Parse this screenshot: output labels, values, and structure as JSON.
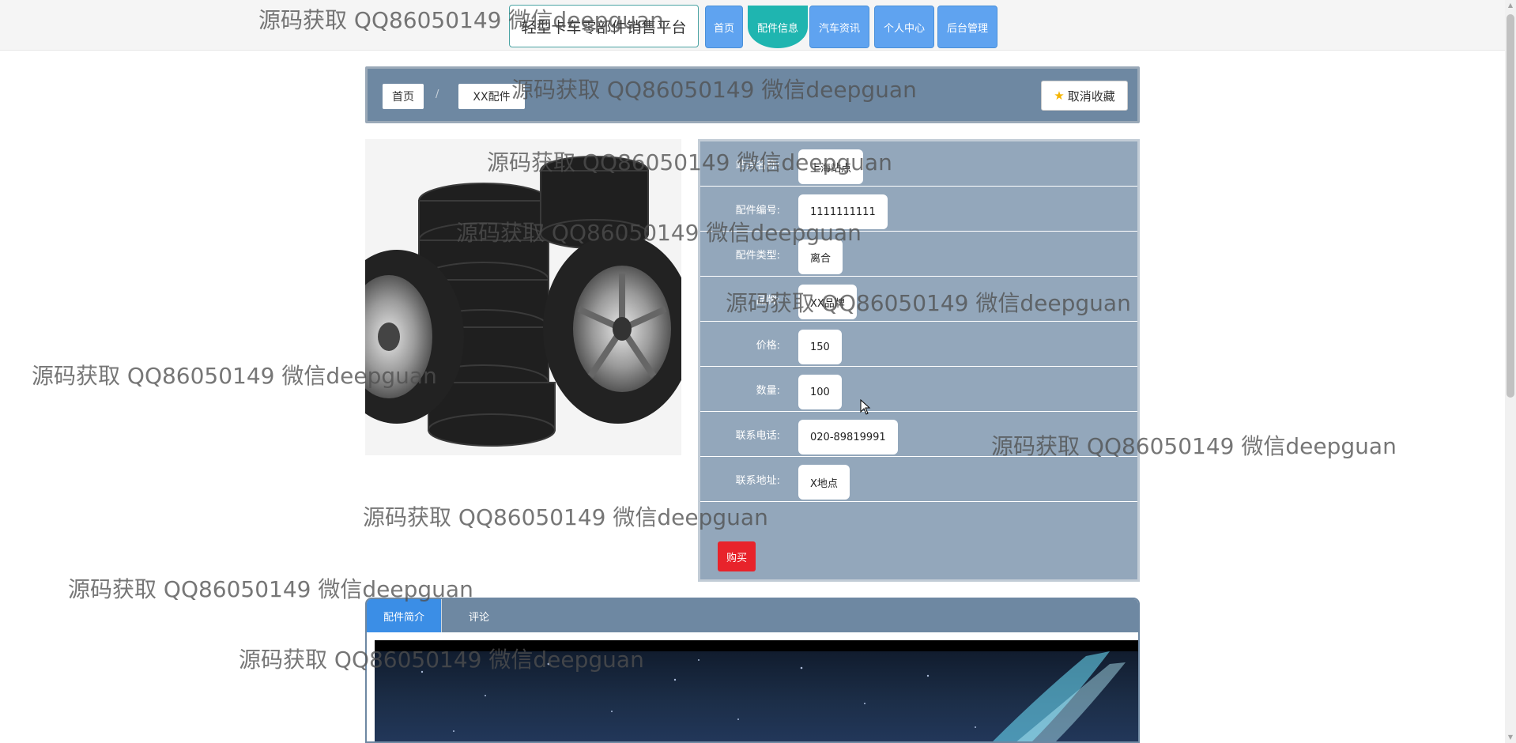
{
  "header": {
    "site_title": "轻型卡车零部件销售平台",
    "nav": [
      {
        "label": "首页",
        "active": false
      },
      {
        "label": "配件信息",
        "active": true
      },
      {
        "label": "汽车资讯",
        "active": false
      },
      {
        "label": "个人中心",
        "active": false
      },
      {
        "label": "后台管理",
        "active": false
      }
    ]
  },
  "breadcrumb": {
    "home": "首页",
    "separator": "/",
    "current": "XX配件"
  },
  "favorite_button": {
    "icon": "star-icon",
    "label": "取消收藏"
  },
  "product": {
    "image_alt": "tires",
    "fields": [
      {
        "label": "站点名称:",
        "value": "上海站点"
      },
      {
        "label": "配件编号:",
        "value": "1111111111"
      },
      {
        "label": "配件类型:",
        "value": "离合"
      },
      {
        "label": "品牌:",
        "value": "XX品牌"
      },
      {
        "label": "价格:",
        "value": "150"
      },
      {
        "label": "数量:",
        "value": "100"
      },
      {
        "label": "联系电话:",
        "value": "020-89819991"
      },
      {
        "label": "联系地址:",
        "value": "X地点"
      }
    ],
    "buy_label": "购买"
  },
  "tabs": [
    {
      "label": "配件简介",
      "active": true
    },
    {
      "label": "评论",
      "active": false
    }
  ],
  "watermark_text": "源码获取 QQ86050149 微信deepguan",
  "colors": {
    "nav_blue": "#5fa3f0",
    "nav_active": "#1fb5b0",
    "panel_bg": "#93a7bb",
    "bar_bg": "#6e88a2",
    "buy_red": "#e8232b",
    "tab_active": "#3b8ee6"
  }
}
